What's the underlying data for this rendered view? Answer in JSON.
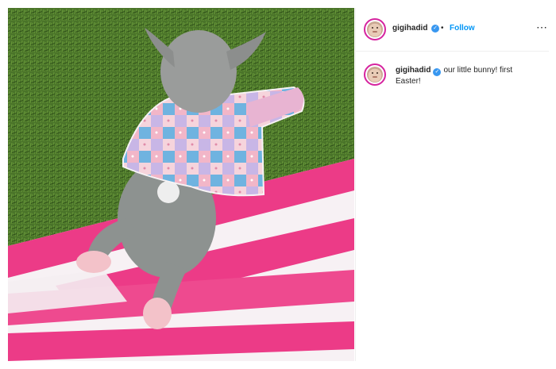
{
  "header": {
    "username": "gigihadid",
    "separator": "•",
    "follow_label": "Follow",
    "more_icon": "⋯"
  },
  "caption": {
    "username": "gigihadid",
    "text": "our little bunny! first Easter!"
  },
  "icons": {
    "verified": "verified-badge-icon",
    "more": "more-options-icon",
    "avatar": "profile-avatar"
  },
  "colors": {
    "follow": "#0095f6",
    "verified": "#3897f0",
    "avatar_ring": "#d6249f",
    "text": "#262626"
  }
}
